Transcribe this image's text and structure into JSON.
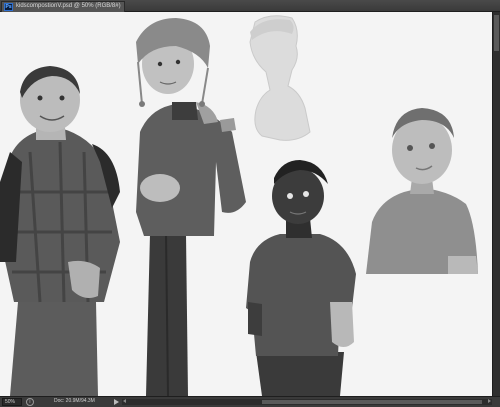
{
  "app": {
    "badge": "Ps",
    "document_tab": "kidscompostionV.psd @ 50% (RGB/8#)"
  },
  "status": {
    "zoom": "50%",
    "doc_info": "Doc: 20.9M/94.3M"
  },
  "colors": {
    "canvas_bg": "#f4f4f4",
    "ui_dark": "#3c3c3c",
    "accent_blue": "#2d6fd1"
  },
  "icons": {
    "info": "info-icon",
    "play": "play-icon",
    "scroll_left": "arrow-left-icon",
    "scroll_right": "arrow-right-icon"
  }
}
